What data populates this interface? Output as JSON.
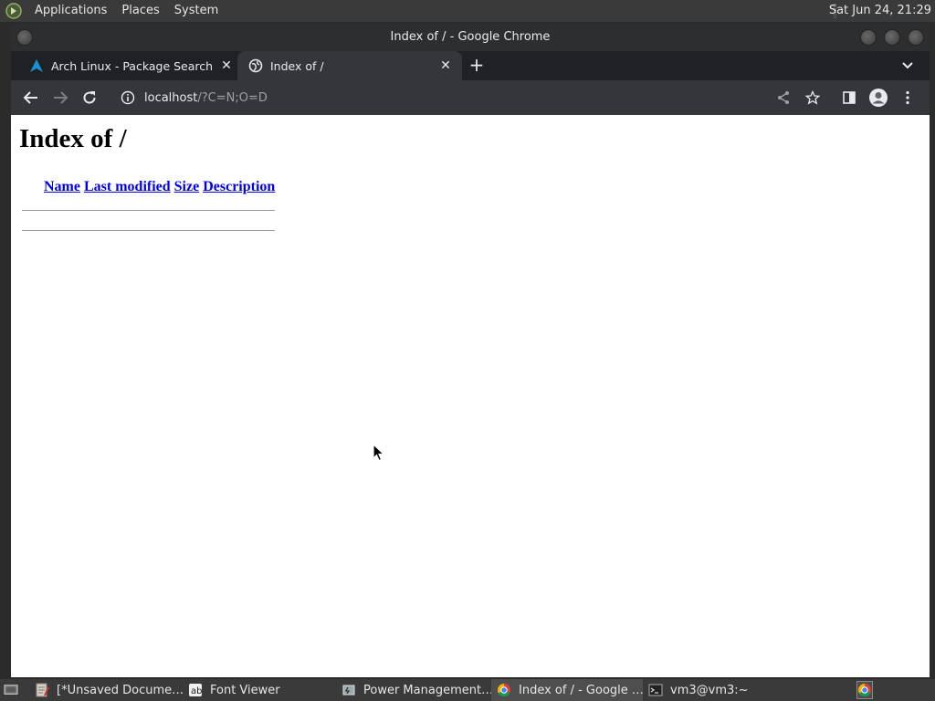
{
  "top_panel": {
    "menus": [
      "Applications",
      "Places",
      "System"
    ],
    "clock": "Sat Jun 24, 21:29"
  },
  "window": {
    "title": "Index of / - Google Chrome"
  },
  "tabs": [
    {
      "title": "Arch Linux - Package Search",
      "icon": "arch-linux-icon"
    },
    {
      "title": "Index of /",
      "icon": "globe-icon",
      "active": true
    }
  ],
  "toolbar": {
    "url_host": "localhost",
    "url_path": "/?C=N;O=D"
  },
  "page": {
    "heading": "Index of /",
    "columns": [
      "Name",
      "Last modified",
      "Size",
      "Description"
    ]
  },
  "taskbar": {
    "tasks": [
      {
        "label": "[*Unsaved Docume…",
        "icon": "text-editor-icon"
      },
      {
        "label": "Font Viewer",
        "icon": "font-viewer-icon"
      },
      {
        "label": "Power Management…",
        "icon": "power-management-icon"
      },
      {
        "label": "Index of / - Google …",
        "icon": "chrome-icon",
        "active": true
      },
      {
        "label": "vm3@vm3:~",
        "icon": "terminal-icon"
      }
    ]
  },
  "colors": {
    "link": "#0000ee",
    "chrome_dark": "#202124",
    "chrome_toolbar": "#35363a"
  }
}
